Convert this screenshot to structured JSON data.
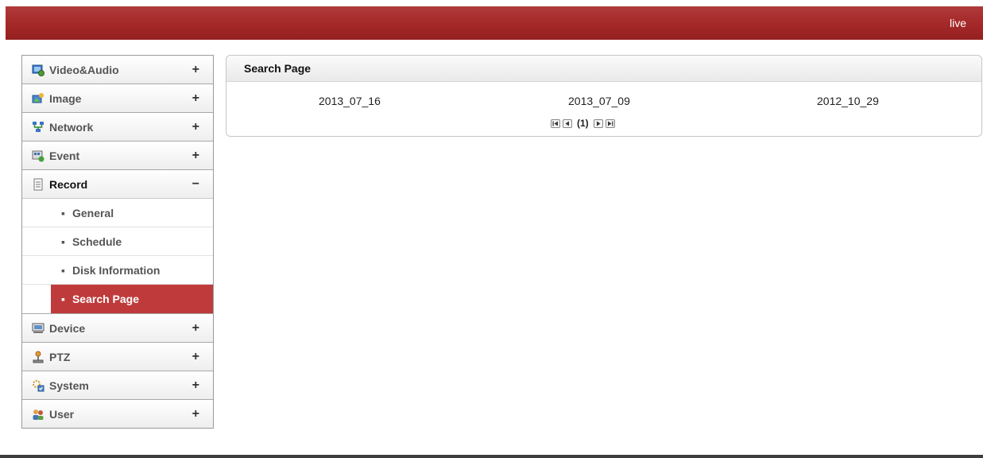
{
  "topbar": {
    "live_label": "live",
    "color": "#a42828"
  },
  "sidebar": {
    "menu_before": [
      {
        "label": "Video&Audio",
        "toggle": "+",
        "icon": "video-audio-icon"
      },
      {
        "label": "Image",
        "toggle": "+",
        "icon": "image-icon"
      },
      {
        "label": "Network",
        "toggle": "+",
        "icon": "network-icon"
      },
      {
        "label": "Event",
        "toggle": "+",
        "icon": "event-icon"
      }
    ],
    "record": {
      "label": "Record",
      "toggle": "−",
      "icon": "record-icon",
      "submenu": [
        {
          "label": "General",
          "bullet": "▪"
        },
        {
          "label": "Schedule",
          "bullet": "▪"
        },
        {
          "label": "Disk Information",
          "bullet": "▪"
        },
        {
          "label": "Search Page",
          "bullet": "▪",
          "active": true
        }
      ]
    },
    "menu_after": [
      {
        "label": "Device",
        "toggle": "+",
        "icon": "device-icon"
      },
      {
        "label": "PTZ",
        "toggle": "+",
        "icon": "ptz-icon"
      },
      {
        "label": "System",
        "toggle": "+",
        "icon": "system-icon"
      },
      {
        "label": "User",
        "toggle": "+",
        "icon": "user-icon"
      }
    ],
    "active_color": "#bf3b3b"
  },
  "panel": {
    "title": "Search Page",
    "dates": [
      "2013_07_16",
      "2013_07_09",
      "2012_10_29"
    ],
    "pager": {
      "page_indicator": "(1)"
    }
  }
}
